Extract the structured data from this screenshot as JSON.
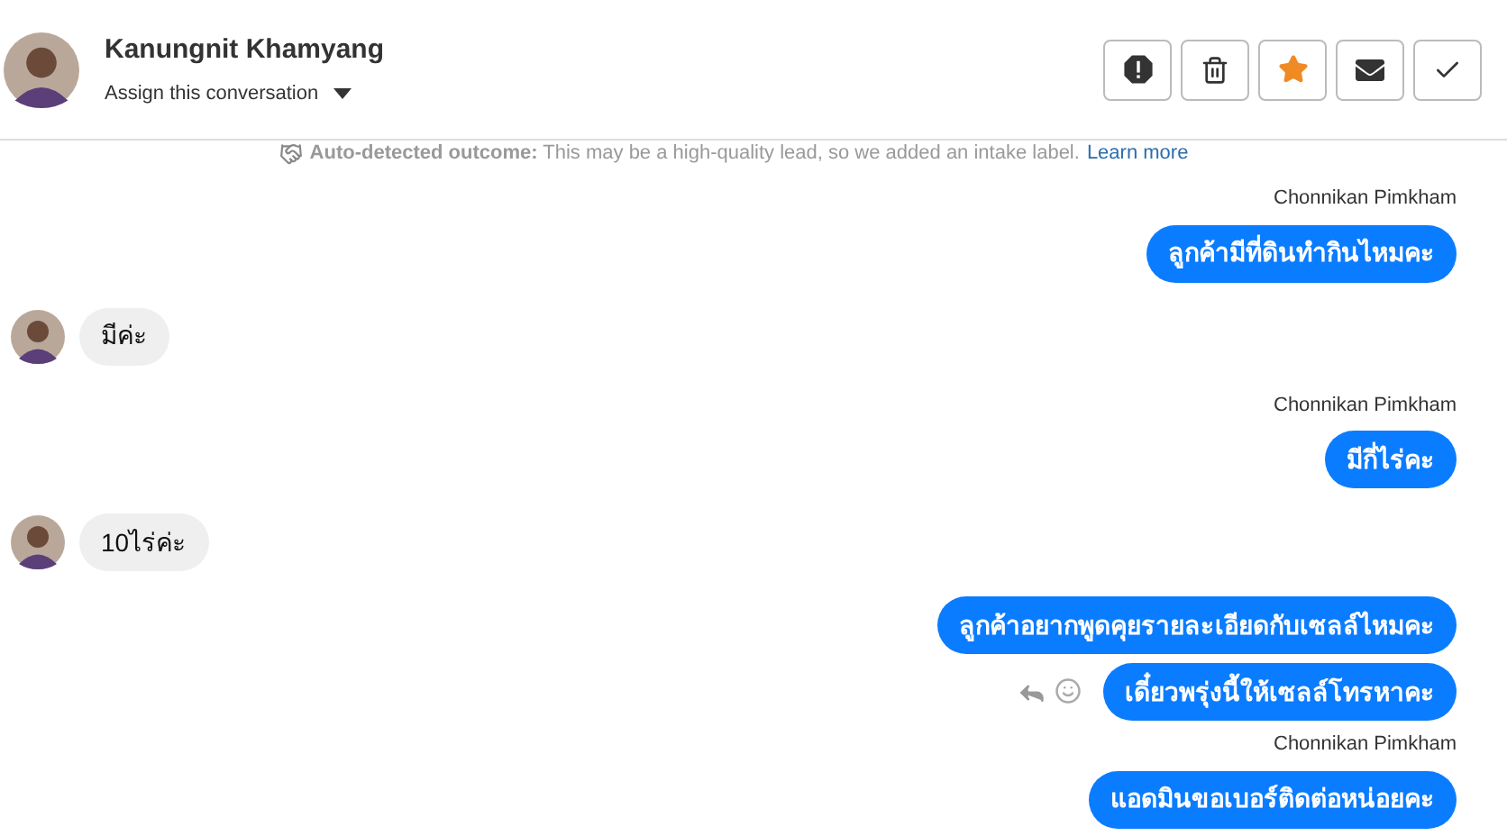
{
  "header": {
    "name": "Kanungnit Khamyang",
    "assign": "Assign this conversation",
    "starred": true
  },
  "notice": {
    "label": "Auto-detected outcome:",
    "text": "This may be a high-quality lead, so we added an intake label.",
    "link": "Learn more"
  },
  "messages": [
    {
      "kind": "outgoing",
      "sender": "Chonnikan Pimkham",
      "text": "ลูกค้ามีที่ดินทำกินไหมคะ"
    },
    {
      "kind": "incoming",
      "text": "มีค่ะ"
    },
    {
      "kind": "outgoing",
      "sender": "Chonnikan Pimkham",
      "text": "มีกี่ไร่คะ"
    },
    {
      "kind": "incoming",
      "text": "10ไร่ค่ะ"
    },
    {
      "kind": "outgoing",
      "text": "ลูกค้าอยากพูดคุยรายละเอียดกับเซลล์ไหมคะ"
    },
    {
      "kind": "outgoing",
      "text": "เดี๋ยวพรุ่งนี้ให้เซลล์โทรหาคะ",
      "hovered": true
    },
    {
      "kind": "outgoing",
      "sender": "Chonnikan Pimkham",
      "text": "แอดมินขอเบอร์ติดต่อหน่อยคะ"
    }
  ]
}
